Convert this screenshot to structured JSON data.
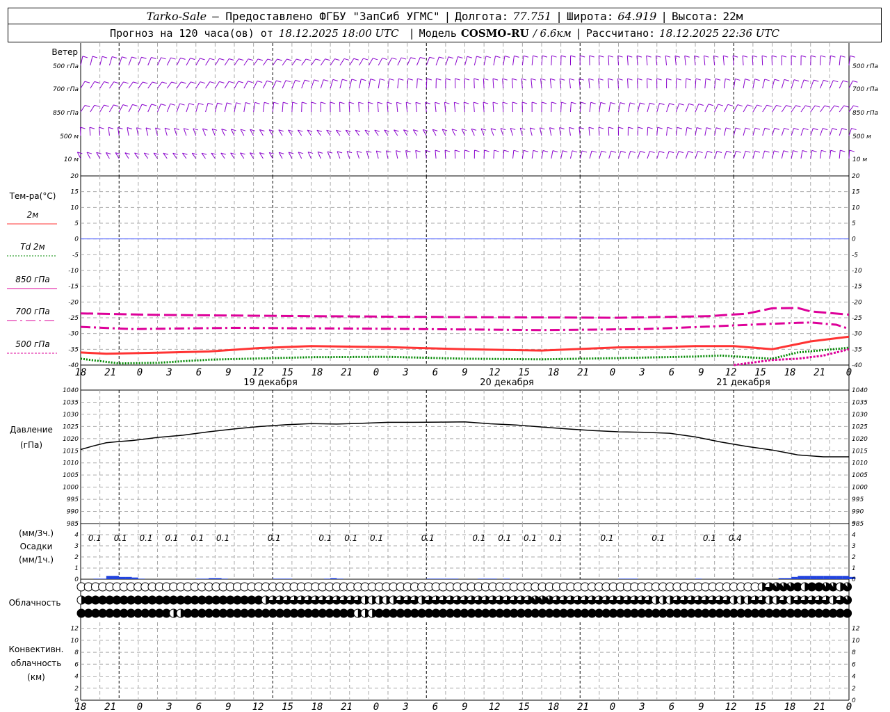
{
  "header": {
    "station": "Tarko-Sale",
    "provider": "– Предоставлено ФГБУ \"ЗапСиб УГМС\"",
    "lon_label": "Долгота:",
    "lon_value": "77.751",
    "lat_label": "Широта:",
    "lat_value": "64.919",
    "alt_label": "Высота:",
    "alt_value": "22м",
    "forecast_label": "Прогноз на 120 часа(ов) от",
    "forecast_start": "18.12.2025 18:00 UTC",
    "model_label": "Модель",
    "model_name": "COSMO-RU",
    "model_res": "/ 6.6км",
    "calc_label": "Рассчитано:",
    "calc_time": "18.12.2025 22:36 UTC"
  },
  "labels": {
    "wind_title": "Ветер",
    "wind_levels": [
      "500 гПа",
      "700 гПа",
      "850 гПа",
      "500 м",
      "10  м"
    ],
    "temp_title": "Тем-ра(°C)",
    "legend": [
      {
        "label": "2м",
        "color": "#ff3333",
        "dash": "solid"
      },
      {
        "label": "Td  2м",
        "color": "#008800",
        "dash": "dotted"
      },
      {
        "label": "850 гПа",
        "color": "#dd0099",
        "dash": "solid"
      },
      {
        "label": "700 гПа",
        "color": "#dd0099",
        "dash": "dashdot"
      },
      {
        "label": "500 гПа",
        "color": "#dd0099",
        "dash": "dashed"
      }
    ],
    "pressure_title": "Давление",
    "pressure_unit": "(гПа)",
    "precip_unit_3h": "(мм/3ч.)",
    "precip_title": "Осадки",
    "precip_unit_1h": "(мм/1ч.)",
    "cloud_title": "Облачность",
    "conv_title": "Конвективн.",
    "conv_title2": "облачность",
    "conv_unit": "(км)",
    "dates": [
      "19 декабря",
      "20 декабря",
      "21 декабря"
    ]
  },
  "colors": {
    "wind": "#8800cc",
    "pressure": "#000000",
    "precip": "#2244dd",
    "zero_line": "#3344ff",
    "grid": "#aaaaaa"
  },
  "chart_data": {
    "type": "line",
    "x_hours": [
      0,
      12,
      24,
      36,
      48,
      60,
      72,
      84,
      96,
      108,
      120
    ],
    "x_tick_labels": [
      "18",
      "21",
      "0",
      "3",
      "6",
      "9",
      "12",
      "15",
      "18",
      "21",
      "0",
      "3",
      "6",
      "9",
      "12",
      "15",
      "18",
      "21",
      "0",
      "3",
      "6",
      "9",
      "12",
      "15",
      "18",
      "21",
      "0"
    ],
    "temperature": {
      "ylim": [
        -40,
        20
      ],
      "yticks": [
        20,
        15,
        10,
        5,
        0,
        -5,
        -10,
        -15,
        -20,
        -25,
        -30,
        -35,
        -40
      ],
      "series": [
        {
          "name": "2м",
          "x": [
            0,
            4,
            12,
            20,
            28,
            36,
            48,
            60,
            72,
            84,
            90,
            96,
            102,
            108,
            114,
            120
          ],
          "y": [
            -36.0,
            -36.4,
            -36.1,
            -35.7,
            -34.6,
            -34.0,
            -34.3,
            -35.0,
            -35.4,
            -34.4,
            -34.3,
            -34.0,
            -34.0,
            -35.0,
            -32.5,
            -31.0
          ]
        },
        {
          "name": "Td  2м",
          "x": [
            0,
            6,
            12,
            20,
            28,
            36,
            48,
            60,
            72,
            84,
            96,
            100,
            108,
            112,
            120
          ],
          "y": [
            -38.0,
            -39.5,
            -39.3,
            -38.3,
            -37.9,
            -37.5,
            -37.4,
            -38.0,
            -38.2,
            -37.8,
            -37.3,
            -37.0,
            -38.0,
            -36.0,
            -34.5
          ]
        },
        {
          "name": "500 гПа",
          "x": [
            102,
            108,
            112,
            116,
            120
          ],
          "y": [
            -40.0,
            -38.4,
            -38.0,
            -37.0,
            -35.0
          ]
        },
        {
          "name": "700 гПа",
          "x": [
            0,
            8,
            24,
            48,
            72,
            88,
            98,
            108,
            112,
            114,
            118,
            120
          ],
          "y": [
            -27.9,
            -28.6,
            -28.2,
            -28.5,
            -28.9,
            -28.6,
            -27.8,
            -26.9,
            -26.6,
            -26.5,
            -27.2,
            -28.5
          ]
        },
        {
          "name": "850 гПа",
          "x": [
            0,
            12,
            36,
            60,
            84,
            98,
            104,
            108,
            112,
            114,
            120
          ],
          "y": [
            -23.6,
            -24.1,
            -24.5,
            -24.8,
            -25.0,
            -24.5,
            -23.7,
            -22.0,
            -21.9,
            -23.0,
            -24.0
          ]
        }
      ]
    },
    "pressure": {
      "ylim": [
        985,
        1040
      ],
      "yticks": [
        1040,
        1035,
        1030,
        1025,
        1020,
        1015,
        1010,
        1005,
        1000,
        995,
        990,
        985
      ],
      "x": [
        0,
        2,
        4,
        6,
        8,
        10,
        12,
        16,
        20,
        24,
        28,
        32,
        36,
        40,
        44,
        48,
        52,
        56,
        60,
        64,
        68,
        72,
        76,
        80,
        84,
        88,
        92,
        96,
        100,
        104,
        108,
        112,
        116,
        120
      ],
      "y": [
        1015.5,
        1017,
        1018.3,
        1018.8,
        1019.2,
        1019.8,
        1020.5,
        1021.4,
        1022.8,
        1024.0,
        1025.0,
        1025.7,
        1026.2,
        1026.0,
        1026.3,
        1026.7,
        1026.7,
        1026.8,
        1026.9,
        1026.1,
        1025.6,
        1024.8,
        1024.0,
        1023.3,
        1022.8,
        1022.6,
        1022.2,
        1020.7,
        1018.6,
        1016.8,
        1015.3,
        1013.3,
        1012.5,
        1012.5
      ]
    },
    "precipitation": {
      "ylim": [
        0,
        5
      ],
      "yticks": [
        5,
        4,
        3,
        2,
        1,
        0
      ],
      "labels": [
        {
          "hour": 2,
          "text": "0.1"
        },
        {
          "hour": 6,
          "text": "0.1"
        },
        {
          "hour": 10,
          "text": "0.1"
        },
        {
          "hour": 14,
          "text": "0.1"
        },
        {
          "hour": 18,
          "text": "0.1"
        },
        {
          "hour": 22,
          "text": "0.1"
        },
        {
          "hour": 30,
          "text": "0.1"
        },
        {
          "hour": 38,
          "text": "0.1"
        },
        {
          "hour": 42,
          "text": "0.1"
        },
        {
          "hour": 46,
          "text": "0.1"
        },
        {
          "hour": 54,
          "text": "0.1"
        },
        {
          "hour": 62,
          "text": "0.1"
        },
        {
          "hour": 66,
          "text": "0.1"
        },
        {
          "hour": 70,
          "text": "0.1"
        },
        {
          "hour": 74,
          "text": "0.1"
        },
        {
          "hour": 82,
          "text": "0.1"
        },
        {
          "hour": 90,
          "text": "0.1"
        },
        {
          "hour": 98,
          "text": "0.1"
        },
        {
          "hour": 102,
          "text": "0.4"
        }
      ],
      "hourly": [
        0,
        0,
        0.05,
        0.05,
        0.3,
        0.3,
        0.2,
        0.2,
        0.15,
        0.05,
        0,
        0,
        0,
        0,
        0,
        0,
        0,
        0,
        0.05,
        0.05,
        0.1,
        0.1,
        0.05,
        0,
        0,
        0,
        0,
        0,
        0,
        0,
        0.05,
        0.05,
        0.05,
        0,
        0,
        0,
        0,
        0,
        0.05,
        0.1,
        0.05,
        0,
        0,
        0,
        0,
        0,
        0,
        0,
        0,
        0,
        0,
        0,
        0,
        0,
        0.05,
        0.05,
        0.05,
        0.05,
        0.05,
        0,
        0,
        0,
        0.05,
        0.05,
        0.05,
        0,
        0.05,
        0,
        0,
        0,
        0,
        0,
        0,
        0,
        0,
        0,
        0,
        0,
        0,
        0,
        0,
        0,
        0,
        0,
        0.05,
        0.05,
        0.05,
        0,
        0,
        0,
        0,
        0,
        0,
        0,
        0,
        0,
        0.05,
        0,
        0,
        0,
        0,
        0,
        0,
        0,
        0,
        0,
        0,
        0,
        0,
        0.1,
        0.1,
        0.2,
        0.3,
        0.3,
        0.3,
        0.3,
        0.3,
        0.3,
        0.3,
        0.3,
        0.2
      ]
    },
    "convective_cloud": {
      "ylim": [
        0,
        13
      ],
      "yticks": [
        12,
        10,
        8,
        6,
        4,
        2,
        0
      ],
      "values": []
    },
    "cloud_high": [
      0,
      0,
      0,
      0,
      0,
      0,
      0,
      0,
      0,
      0,
      0,
      0,
      0,
      0,
      0,
      0,
      0,
      0,
      0,
      0,
      0,
      0,
      0,
      0,
      0,
      0,
      0,
      0,
      0,
      0,
      0,
      0,
      0,
      0,
      0,
      0,
      0,
      0,
      0,
      0,
      0,
      0,
      0,
      0,
      0,
      0,
      0,
      0,
      0,
      0,
      0,
      0,
      0,
      0,
      0,
      0,
      0,
      0,
      0,
      0,
      0,
      0,
      0,
      0,
      0,
      0,
      0,
      0,
      0,
      0,
      0,
      0,
      0,
      0,
      0,
      0,
      0,
      0,
      0,
      0,
      0,
      0,
      0,
      0,
      0,
      0,
      0,
      0,
      0,
      0,
      0,
      0,
      0,
      0,
      0,
      0,
      0.5,
      0.75,
      0.9,
      0.9,
      0.9,
      1,
      0.5,
      1,
      1,
      0.9,
      0.9,
      0.5,
      0.9
    ],
    "cloud_mid": [
      0.5,
      1,
      1,
      1,
      1,
      1,
      1,
      1,
      1,
      1,
      1,
      1,
      1,
      1,
      1,
      1,
      1,
      1,
      1,
      1,
      1,
      1,
      1,
      1,
      1,
      1,
      0.5,
      0.75,
      0.75,
      0.75,
      0.75,
      0.75,
      0.75,
      0.75,
      0.75,
      0.75,
      0.75,
      0.75,
      0.75,
      0.75,
      0.5,
      0.5,
      0.5,
      0.5,
      0.5,
      0.75,
      0.75,
      0.75,
      0.5,
      0.75,
      0.75,
      0.75,
      0.75,
      0.75,
      0.75,
      0.75,
      0.75,
      0.75,
      0.75,
      0.75,
      0.75,
      0.75,
      0.75,
      0.75,
      0.9,
      0.9,
      0.9,
      0.75,
      0.75,
      0.75,
      0.75,
      0.75,
      0.75,
      0.75,
      0.75,
      0.75,
      0.75,
      0.75,
      0.75,
      0.75,
      0.75,
      0.5,
      0.5,
      0.5,
      0.75,
      0.75,
      0.75,
      0.75,
      0.75,
      0.75,
      0.75,
      0.75,
      0.5,
      0.5,
      0.5,
      0.75,
      0.75,
      0.5,
      0.5,
      0.75,
      0.5,
      0.75,
      0.75,
      0.75,
      0.75,
      0.75,
      0.5,
      0.75,
      0.9
    ],
    "cloud_low": [
      1,
      1,
      1,
      1,
      1,
      1,
      1,
      1,
      1,
      1,
      1,
      1,
      1,
      0.5,
      0.5,
      1,
      1,
      1,
      1,
      1,
      1,
      1,
      1,
      1,
      1,
      1,
      1,
      1,
      1,
      1,
      1,
      1,
      1,
      1,
      1,
      1,
      1,
      1,
      1,
      0.5,
      0.5,
      0.5,
      1,
      1,
      1,
      1,
      1,
      1,
      1,
      1,
      1,
      1,
      1,
      1,
      1,
      1,
      1,
      1,
      1,
      1,
      1,
      1,
      1,
      1,
      1,
      1,
      1,
      1,
      1,
      1,
      1,
      1,
      1,
      1,
      1,
      1,
      1,
      1,
      1,
      1,
      1,
      1,
      1,
      1,
      1,
      1,
      1,
      1,
      1,
      1,
      1,
      1,
      1,
      1,
      1,
      1,
      1,
      1,
      1,
      1,
      1,
      1,
      1,
      1,
      1,
      1,
      1,
      1,
      1
    ]
  }
}
